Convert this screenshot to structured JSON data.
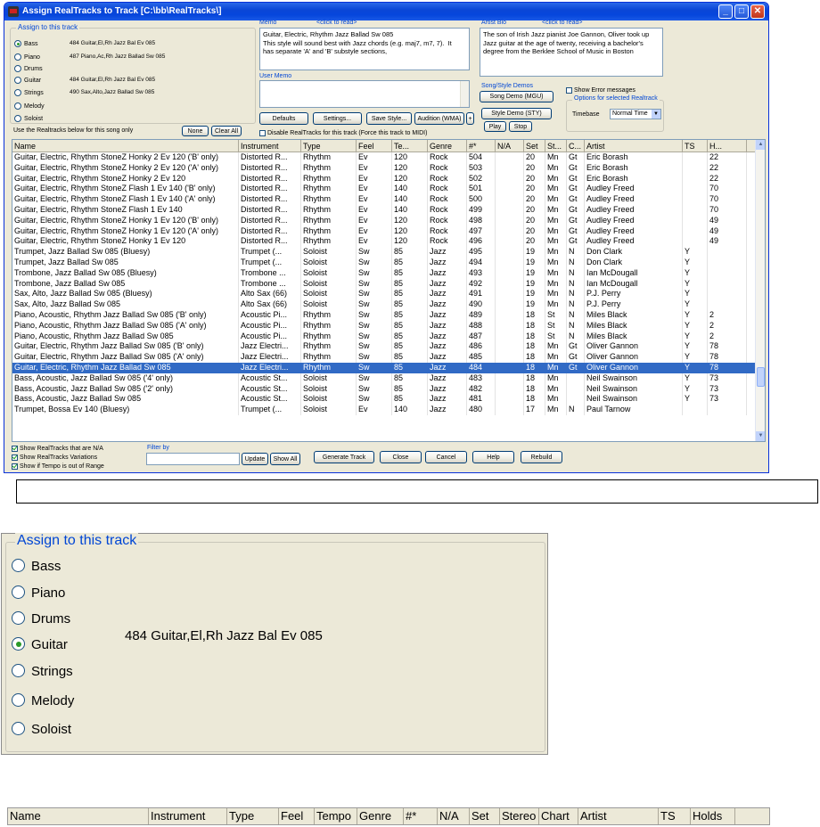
{
  "window": {
    "title": "Assign RealTracks to Track  [C:\\bb\\RealTracks\\]",
    "minimize": "_",
    "maximize": "□",
    "close": "✕"
  },
  "assign": {
    "legend": "Assign to this track",
    "options": [
      {
        "label": "Bass",
        "value": "484 Guitar,El,Rh Jazz Bal Ev 085",
        "selected": true
      },
      {
        "label": "Piano",
        "value": "487 Piano,Ac,Rh Jazz Ballad Sw 085",
        "selected": false
      },
      {
        "label": "Drums",
        "value": "",
        "selected": false
      },
      {
        "label": "Guitar",
        "value": "484 Guitar,El,Rh Jazz Bal Ev 085",
        "selected": false
      },
      {
        "label": "Strings",
        "value": "490 Sax,Alto,Jazz Ballad Sw 085",
        "selected": false
      },
      {
        "label": "Melody",
        "value": "",
        "selected": false
      },
      {
        "label": "Soloist",
        "value": "",
        "selected": false
      }
    ],
    "use_label": "Use the Realtracks below for this song only",
    "none_button": "None",
    "clear_all_button": "Clear All"
  },
  "memo": {
    "label": "Memo",
    "click_hint": "<click to read>",
    "text": "Guitar, Electric, Rhythm Jazz Ballad Sw 085\nThis style will sound best with Jazz chords (e.g. maj7, m7, 7).  It has separate 'A' and 'B' substyle sections,"
  },
  "artist_bio": {
    "label": "Artist Bio",
    "click_hint": "<click to read>",
    "text": "The son of Irish Jazz pianist Joe Gannon, Oliver took up Jazz guitar at the age of twenty, receiving a bachelor's degree from the Berklee School of Music in Boston"
  },
  "user_memo": {
    "label": "User Memo",
    "text": ""
  },
  "buttons": {
    "defaults": "Defaults",
    "settings": "Settings...",
    "save_style": "Save Style...",
    "audition": "Audition (WMA)",
    "plus": "+",
    "song_demo": "Song Demo (MGU)",
    "style_demo": "Style Demo (STY)",
    "play": "Play",
    "stop": "Stop",
    "update": "Update",
    "show_all": "Show All",
    "generate": "Generate Track",
    "close": "Close",
    "cancel": "Cancel",
    "help": "Help",
    "rebuild": "Rebuild"
  },
  "demos": {
    "label": "Song/Style Demos"
  },
  "disable_realtracks": {
    "label": "Disable RealTracks for this track (Force this track to MIDI)",
    "checked": false
  },
  "options": {
    "show_error": {
      "label": "Show Error messages",
      "checked": false
    },
    "legend": "Options for selected Realtrack",
    "timebase_label": "Timebase",
    "timebase_value": "Normal Time"
  },
  "filters": {
    "show_na": {
      "label": "Show RealTracks that are N/A",
      "checked": true
    },
    "show_variations": {
      "label": "Show RealTracks Variations",
      "checked": true
    },
    "show_tempo": {
      "label": "Show if Tempo is out of Range",
      "checked": true
    },
    "filter_label": "Filter by",
    "filter_value": ""
  },
  "table": {
    "columns": [
      "Name",
      "Instrument",
      "Type",
      "Feel",
      "Te...",
      "Genre",
      "#*",
      "N/A",
      "Set",
      "St...",
      "C...",
      "Artist",
      "TS",
      "H..."
    ],
    "rows": [
      [
        "Guitar, Electric, Rhythm StoneZ Honky 2 Ev 120 ('B' only)",
        "Distorted R...",
        "Rhythm",
        "Ev",
        "120",
        "Rock",
        "504",
        "",
        "20",
        "Mn",
        "Gt",
        "Eric Borash",
        "",
        "22"
      ],
      [
        "Guitar, Electric, Rhythm StoneZ Honky 2 Ev 120 ('A' only)",
        "Distorted R...",
        "Rhythm",
        "Ev",
        "120",
        "Rock",
        "503",
        "",
        "20",
        "Mn",
        "Gt",
        "Eric Borash",
        "",
        "22"
      ],
      [
        "Guitar, Electric, Rhythm StoneZ Honky 2 Ev 120",
        "Distorted R...",
        "Rhythm",
        "Ev",
        "120",
        "Rock",
        "502",
        "",
        "20",
        "Mn",
        "Gt",
        "Eric Borash",
        "",
        "22"
      ],
      [
        "Guitar, Electric, Rhythm StoneZ Flash 1 Ev 140 ('B' only)",
        "Distorted R...",
        "Rhythm",
        "Ev",
        "140",
        "Rock",
        "501",
        "",
        "20",
        "Mn",
        "Gt",
        "Audley Freed",
        "",
        "70"
      ],
      [
        "Guitar, Electric, Rhythm StoneZ Flash 1 Ev 140 ('A' only)",
        "Distorted R...",
        "Rhythm",
        "Ev",
        "140",
        "Rock",
        "500",
        "",
        "20",
        "Mn",
        "Gt",
        "Audley Freed",
        "",
        "70"
      ],
      [
        "Guitar, Electric, Rhythm StoneZ Flash 1 Ev 140",
        "Distorted R...",
        "Rhythm",
        "Ev",
        "140",
        "Rock",
        "499",
        "",
        "20",
        "Mn",
        "Gt",
        "Audley Freed",
        "",
        "70"
      ],
      [
        "Guitar, Electric, Rhythm StoneZ Honky 1 Ev 120 ('B' only)",
        "Distorted R...",
        "Rhythm",
        "Ev",
        "120",
        "Rock",
        "498",
        "",
        "20",
        "Mn",
        "Gt",
        "Audley Freed",
        "",
        "49"
      ],
      [
        "Guitar, Electric, Rhythm StoneZ Honky 1 Ev 120 ('A' only)",
        "Distorted R...",
        "Rhythm",
        "Ev",
        "120",
        "Rock",
        "497",
        "",
        "20",
        "Mn",
        "Gt",
        "Audley Freed",
        "",
        "49"
      ],
      [
        "Guitar, Electric, Rhythm StoneZ Honky 1 Ev 120",
        "Distorted R...",
        "Rhythm",
        "Ev",
        "120",
        "Rock",
        "496",
        "",
        "20",
        "Mn",
        "Gt",
        "Audley Freed",
        "",
        "49"
      ],
      [
        "Trumpet, Jazz Ballad Sw 085 (Bluesy)",
        "Trumpet (...",
        "Soloist",
        "Sw",
        "85",
        "Jazz",
        "495",
        "",
        "19",
        "Mn",
        "N",
        "Don Clark",
        "Y",
        ""
      ],
      [
        "Trumpet, Jazz Ballad Sw 085",
        "Trumpet (...",
        "Soloist",
        "Sw",
        "85",
        "Jazz",
        "494",
        "",
        "19",
        "Mn",
        "N",
        "Don Clark",
        "Y",
        ""
      ],
      [
        "Trombone, Jazz Ballad Sw 085 (Bluesy)",
        "Trombone ...",
        "Soloist",
        "Sw",
        "85",
        "Jazz",
        "493",
        "",
        "19",
        "Mn",
        "N",
        "Ian McDougall",
        "Y",
        ""
      ],
      [
        "Trombone, Jazz Ballad Sw 085",
        "Trombone ...",
        "Soloist",
        "Sw",
        "85",
        "Jazz",
        "492",
        "",
        "19",
        "Mn",
        "N",
        "Ian McDougall",
        "Y",
        ""
      ],
      [
        "Sax, Alto, Jazz Ballad Sw 085 (Bluesy)",
        "Alto Sax (66)",
        "Soloist",
        "Sw",
        "85",
        "Jazz",
        "491",
        "",
        "19",
        "Mn",
        "N",
        "P.J. Perry",
        "Y",
        ""
      ],
      [
        "Sax, Alto, Jazz Ballad Sw 085",
        "Alto Sax (66)",
        "Soloist",
        "Sw",
        "85",
        "Jazz",
        "490",
        "",
        "19",
        "Mn",
        "N",
        "P.J. Perry",
        "Y",
        ""
      ],
      [
        "Piano, Acoustic, Rhythm Jazz Ballad Sw 085 ('B' only)",
        "Acoustic Pi...",
        "Rhythm",
        "Sw",
        "85",
        "Jazz",
        "489",
        "",
        "18",
        "St",
        "N",
        "Miles Black",
        "Y",
        "2"
      ],
      [
        "Piano, Acoustic, Rhythm Jazz Ballad Sw 085 ('A' only)",
        "Acoustic Pi...",
        "Rhythm",
        "Sw",
        "85",
        "Jazz",
        "488",
        "",
        "18",
        "St",
        "N",
        "Miles Black",
        "Y",
        "2"
      ],
      [
        "Piano, Acoustic, Rhythm Jazz Ballad Sw 085",
        "Acoustic Pi...",
        "Rhythm",
        "Sw",
        "85",
        "Jazz",
        "487",
        "",
        "18",
        "St",
        "N",
        "Miles Black",
        "Y",
        "2"
      ],
      [
        "Guitar, Electric, Rhythm Jazz Ballad Sw 085 ('B' only)",
        "Jazz Electri...",
        "Rhythm",
        "Sw",
        "85",
        "Jazz",
        "486",
        "",
        "18",
        "Mn",
        "Gt",
        "Oliver Gannon",
        "Y",
        "78"
      ],
      [
        "Guitar, Electric, Rhythm Jazz Ballad Sw 085 ('A' only)",
        "Jazz Electri...",
        "Rhythm",
        "Sw",
        "85",
        "Jazz",
        "485",
        "",
        "18",
        "Mn",
        "Gt",
        "Oliver Gannon",
        "Y",
        "78"
      ],
      [
        "Guitar, Electric, Rhythm Jazz Ballad Sw 085",
        "Jazz Electri...",
        "Rhythm",
        "Sw",
        "85",
        "Jazz",
        "484",
        "",
        "18",
        "Mn",
        "Gt",
        "Oliver Gannon",
        "Y",
        "78"
      ],
      [
        "Bass, Acoustic, Jazz Ballad Sw 085 ('4' only)",
        "Acoustic St...",
        "Soloist",
        "Sw",
        "85",
        "Jazz",
        "483",
        "",
        "18",
        "Mn",
        "",
        "Neil Swainson",
        "Y",
        "73"
      ],
      [
        "Bass, Acoustic, Jazz Ballad Sw 085 ('2' only)",
        "Acoustic St...",
        "Soloist",
        "Sw",
        "85",
        "Jazz",
        "482",
        "",
        "18",
        "Mn",
        "",
        "Neil Swainson",
        "Y",
        "73"
      ],
      [
        "Bass, Acoustic, Jazz Ballad Sw 085",
        "Acoustic St...",
        "Soloist",
        "Sw",
        "85",
        "Jazz",
        "481",
        "",
        "18",
        "Mn",
        "",
        "Neil Swainson",
        "Y",
        "73"
      ],
      [
        "Trumpet, Bossa Ev 140 (Bluesy)",
        "Trumpet (...",
        "Soloist",
        "Ev",
        "140",
        "Jazz",
        "480",
        "",
        "17",
        "Mn",
        "N",
        "Paul Tarnow",
        "",
        ""
      ]
    ],
    "selected_index": 20
  },
  "zoom_panel": {
    "legend": "Assign to this track",
    "options": [
      {
        "label": "Bass",
        "selected": false
      },
      {
        "label": "Piano",
        "selected": false
      },
      {
        "label": "Drums",
        "selected": false
      },
      {
        "label": "Guitar",
        "selected": true
      },
      {
        "label": "Strings",
        "selected": false
      },
      {
        "label": "Melody",
        "selected": false
      },
      {
        "label": "Soloist",
        "selected": false
      }
    ],
    "guitar_value": "484 Guitar,El,Rh Jazz Bal Ev 085"
  },
  "header_strip": {
    "columns": [
      "Name",
      "Instrument",
      "Type",
      "Feel",
      "Tempo",
      "Genre",
      "#*",
      "N/A",
      "Set",
      "Stereo",
      "Chart",
      "Artist",
      "TS",
      "Holds"
    ]
  },
  "colors": {
    "selection": "#316ac5",
    "titlebar": "#0a46d6",
    "accent_blue": "#0046d5"
  }
}
